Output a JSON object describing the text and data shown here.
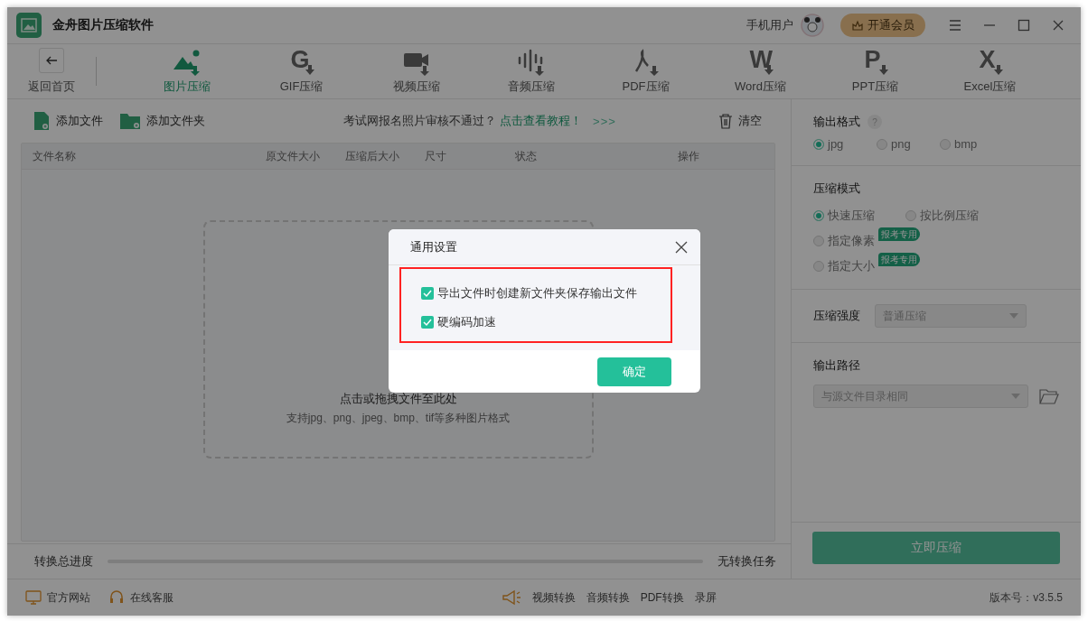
{
  "window": {
    "title": "金舟图片压缩软件"
  },
  "account": {
    "user": "手机用户",
    "vip": "开通会员"
  },
  "nav": {
    "back": "返回首页",
    "tabs": [
      {
        "label": "图片压缩",
        "kind": "image",
        "selected": true
      },
      {
        "label": "GIF压缩",
        "kind": "letter",
        "glyph": "G",
        "selected": false
      },
      {
        "label": "视频压缩",
        "kind": "video",
        "selected": false
      },
      {
        "label": "音频压缩",
        "kind": "audio",
        "selected": false
      },
      {
        "label": "PDF压缩",
        "kind": "pdf",
        "selected": false
      },
      {
        "label": "Word压缩",
        "kind": "letter",
        "glyph": "W",
        "selected": false
      },
      {
        "label": "PPT压缩",
        "kind": "letter",
        "glyph": "P",
        "selected": false
      },
      {
        "label": "Excel压缩",
        "kind": "letter",
        "glyph": "X",
        "selected": false
      }
    ]
  },
  "toolbar": {
    "add_file": "添加文件",
    "add_folder": "添加文件夹",
    "notice": "考试网报名照片审核不通过？",
    "notice_link": "点击查看教程！",
    "chevrons": ">>>",
    "clear": "清空"
  },
  "table": {
    "columns": [
      "文件名称",
      "原文件大小",
      "压缩后大小",
      "尺寸",
      "状态",
      "操作"
    ]
  },
  "drop_zone": {
    "title": "点击或拖拽文件至此处",
    "hint": "支持jpg、png、jpeg、bmp、tif等多种图片格式"
  },
  "progress": {
    "label": "转换总进度",
    "level": 0,
    "status": "无转换任务"
  },
  "settings": {
    "format": {
      "label": "输出格式",
      "help": "?",
      "options": [
        {
          "label": "jpg",
          "selected": true
        },
        {
          "label": "png",
          "selected": false
        },
        {
          "label": "bmp",
          "selected": false
        }
      ]
    },
    "mode": {
      "label": "压缩模式",
      "options": [
        {
          "label": "快速压缩",
          "selected": true
        },
        {
          "label": "按比例压缩",
          "selected": false
        },
        {
          "label": "指定像素",
          "badge": "报考专用",
          "selected": false
        },
        {
          "label": "指定大小",
          "badge": "报考专用",
          "selected": false
        }
      ]
    },
    "strength": {
      "label": "压缩强度",
      "value": "普通压缩"
    },
    "output": {
      "label": "输出路径",
      "value": "与源文件目录相同"
    },
    "start": "立即压缩"
  },
  "footer": {
    "links": [
      "官方网站",
      "在线客服"
    ],
    "tools": [
      "视频转换",
      "音频转换",
      "PDF转换",
      "录屏"
    ],
    "version": "版本号：v3.5.5"
  },
  "dialog": {
    "title": "通用设置",
    "options": [
      {
        "label": "导出文件时创建新文件夹保存输出文件",
        "checked": true
      },
      {
        "label": "硬编码加速",
        "checked": true
      }
    ],
    "ok": "确定"
  }
}
